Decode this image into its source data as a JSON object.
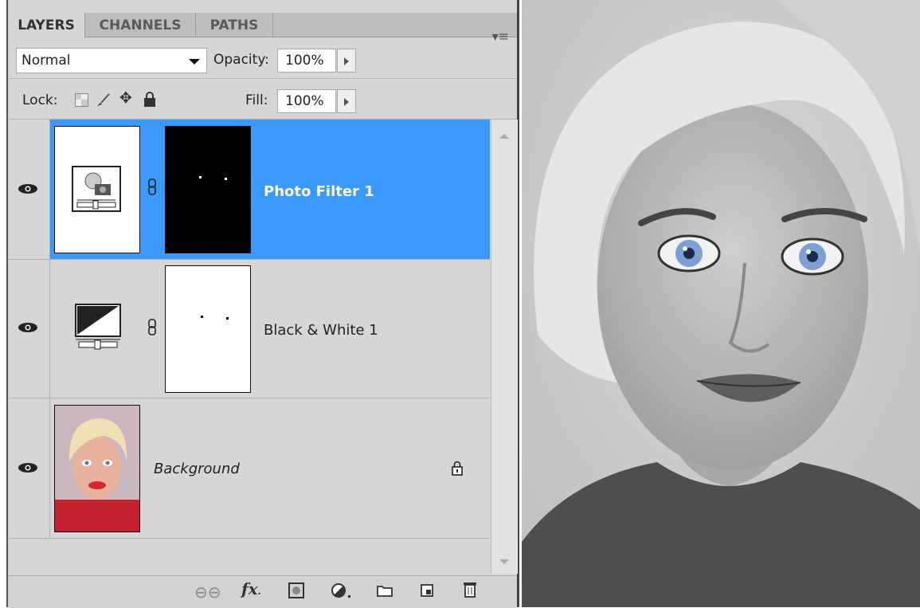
{
  "tabs": [
    {
      "label": "LAYERS"
    },
    {
      "label": "CHANNELS"
    },
    {
      "label": "PATHS"
    }
  ],
  "blend_mode": "Normal",
  "opacity": {
    "label": "Opacity:",
    "value": "100%"
  },
  "lock": {
    "label": "Lock:"
  },
  "fill": {
    "label": "Fill:",
    "value": "100%"
  },
  "layers": [
    {
      "name": "Photo Filter 1",
      "selected": true
    },
    {
      "name": "Black & White 1",
      "selected": false
    },
    {
      "name": "Background",
      "selected": false,
      "locked": true
    }
  ],
  "colors": {
    "selection": "#3b99fc",
    "panel": "#d6d6d6"
  }
}
